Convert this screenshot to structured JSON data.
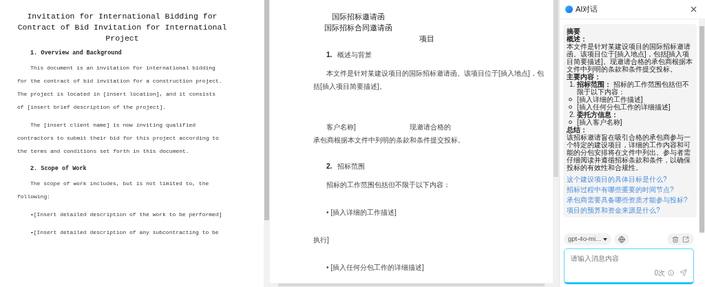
{
  "left_document": {
    "title": "Invitation for International Bidding for Contract of Bid Invitation for International Project",
    "blocks": [
      {
        "kind": "heading",
        "text": "1. Overview and Background"
      },
      {
        "kind": "paragraph",
        "text": "This document is an invitation for international bidding for the contract of bid invitation for a construction project. The project is located in [insert location], and it consists of [insert brief description of the project]."
      },
      {
        "kind": "paragraph",
        "text": "The [insert client name] is now inviting qualified contractors to submit their bid for this project according to the terms and conditions set forth in this document."
      },
      {
        "kind": "heading",
        "text": "2. Scope of Work"
      },
      {
        "kind": "paragraph",
        "text": "The scope of work includes, but is not limited to, the following:"
      },
      {
        "kind": "paragraph",
        "text": "•[Insert detailed description of the work to be performed]"
      },
      {
        "kind": "paragraph",
        "text": "•[Insert detailed description of any subcontracting to be"
      }
    ]
  },
  "middle_document": {
    "titles": [
      "国际招标邀请函",
      "国际招标合同邀请函"
    ],
    "blocks": [
      {
        "kind": "subtitle",
        "text": "项目"
      },
      {
        "kind": "heading",
        "number": "1.",
        "text": "概述与背景"
      },
      {
        "kind": "paragraph",
        "text": "本文件是针对某建设项目的国际招标邀请函。该项目位于[插入地点]，包括[插入项目简要描述]。"
      },
      {
        "kind": "split",
        "text": "客户名称]",
        "text_right": "现邀请合格的"
      },
      {
        "kind": "continuation",
        "text": "承包商根据本文件中列明的条款和条件提交投标。"
      },
      {
        "kind": "heading",
        "number": "2.",
        "text": "招标范围"
      },
      {
        "kind": "indented",
        "text": "招标的工作范围包括但不限于以下内容："
      },
      {
        "kind": "indented",
        "text": "• [插入详细的工作描述]"
      },
      {
        "kind": "continuation",
        "text": "执行]"
      },
      {
        "kind": "indented",
        "text": "• [插入任何分包工作的详细描述]"
      }
    ]
  },
  "ai_panel": {
    "title": "AI对话",
    "summary": [
      {
        "kind": "title",
        "text": "摘要"
      },
      {
        "kind": "label",
        "text": "概述："
      },
      {
        "kind": "paragraph",
        "text": "本文件是针对某建设项目的国际招标邀请函。该项目位于[插入地点]，包括[插入项目简要描述]。现邀请合格的承包商根据本文件中列明的条款和条件提交投标。"
      },
      {
        "kind": "label",
        "text": "主要内容："
      },
      {
        "kind": "numbered",
        "number": "1.",
        "label": "招标范围：",
        "text": "招标的工作范围包括但不限于以下内容："
      },
      {
        "kind": "bullet",
        "text": "[插入详细的工作描述]"
      },
      {
        "kind": "bullet",
        "text": "[插入任何分包工作的详细描述]"
      },
      {
        "kind": "numbered",
        "number": "2.",
        "label": "委托方信息："
      },
      {
        "kind": "bullet",
        "text": "[插入客户名称]"
      },
      {
        "kind": "label",
        "text": "总结："
      },
      {
        "kind": "paragraph",
        "text": "该招标邀请旨在吸引合格的承包商参与一个特定的建设项目，详细的工作内容和可能的分包安排将在文件中列出。参与者需仔细阅读并遵循招标条款和条件，以确保投标的有效性和合规性。"
      }
    ],
    "suggestions": [
      "这个建设项目的具体目标是什么?",
      "招标过程中有哪些重要的时间节点?",
      "承包商需要具备哪些资质才能参与投标?",
      "项目的预算和资金来源是什么?"
    ],
    "model": "gpt-4o-mi...",
    "input": {
      "placeholder": "请输入消息内容"
    },
    "usage": "0次"
  }
}
